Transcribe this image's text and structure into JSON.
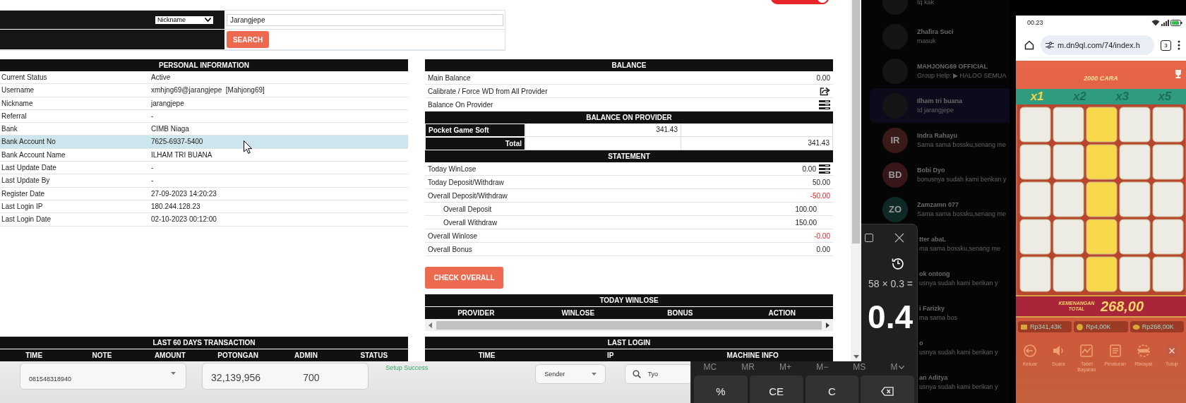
{
  "admin_window": {
    "toggle": {
      "on": true
    },
    "search": {
      "field_select": "Nickname",
      "value": "Jarangjepe",
      "button": "SEARCH"
    },
    "personal_information": {
      "title": "PERSONAL INFORMATION",
      "rows": [
        {
          "label": "Current Status",
          "value": "Active",
          "highlighted": false
        },
        {
          "label": "Username",
          "value": "xmhjng69@jarangjepe  [Mahjong69]",
          "highlighted": false
        },
        {
          "label": "Nickname",
          "value": "jarangjepe",
          "highlighted": false
        },
        {
          "label": "Referral",
          "value": "-",
          "highlighted": false
        },
        {
          "label": "Bank",
          "value": "CIMB Niaga",
          "highlighted": false
        },
        {
          "label": "Bank Account No",
          "value": "7625-6937-5400",
          "highlighted": true
        },
        {
          "label": "Bank Account Name",
          "value": "ILHAM TRI BUANA",
          "highlighted": false
        },
        {
          "label": "Last Update Date",
          "value": "-",
          "highlighted": false
        },
        {
          "label": "Last Update By",
          "value": "-",
          "highlighted": false
        },
        {
          "label": "Register Date",
          "value": "27-09-2023 14:20:23",
          "highlighted": false
        },
        {
          "label": "Last Login IP",
          "value": "180.244.128.23",
          "highlighted": false
        },
        {
          "label": "Last Login Date",
          "value": "02-10-2023 00:12:00",
          "highlighted": false
        }
      ]
    },
    "balance": {
      "title": "BALANCE",
      "rows": [
        {
          "label": "Main Balance",
          "value": "0.00",
          "kind": "value"
        },
        {
          "label": "Calibrate / Force WD from All Provider",
          "kind": "share"
        },
        {
          "label": "Balance On Provider",
          "kind": "list"
        }
      ]
    },
    "balance_on_provider": {
      "title": "BALANCE ON PROVIDER",
      "rows": [
        {
          "label": "Pocket Game Soft",
          "value": "341.43",
          "kind": "provider"
        },
        {
          "label": "Total",
          "value": "341.43",
          "kind": "total"
        }
      ]
    },
    "statement": {
      "title": "STATEMENT",
      "rows": [
        {
          "label": "Today WinLose",
          "value": "0.00",
          "kind": "list",
          "negative": false
        },
        {
          "label": "Today Deposit/Withdraw",
          "value": "50.00",
          "kind": "main",
          "negative": false
        },
        {
          "label": "Overall Deposit/Withdraw",
          "value": "-50.00",
          "kind": "main",
          "negative": true
        },
        {
          "label": "Overall Deposit",
          "value": "100.00",
          "kind": "sub",
          "negative": false
        },
        {
          "label": "Overall Withdraw",
          "value": "150.00",
          "kind": "sub",
          "negative": false
        },
        {
          "label": "Overall Winlose",
          "value": "-0.00",
          "kind": "main",
          "negative": true
        },
        {
          "label": "Overall Bonus",
          "value": "0.00",
          "kind": "main",
          "negative": false
        }
      ]
    },
    "check_button": "CHECK OVERALL",
    "today_winlose": {
      "title": "TODAY WINLOSE",
      "columns": [
        "PROVIDER",
        "WINLOSE",
        "BONUS",
        "ACTION"
      ]
    },
    "last_60_days_transaction": {
      "title": "LAST 60 DAYS TRANSACTION",
      "columns": [
        "TIME",
        "NOTE",
        "AMOUNT",
        "POTONGAN",
        "ADMIN",
        "STATUS"
      ]
    },
    "last_login": {
      "title": "LAST LOGIN",
      "columns": [
        "TIME",
        "IP",
        "MACHINE INFO"
      ]
    }
  },
  "background_app": {
    "phone_field": "081548318940",
    "amount": "32,139,956",
    "fee": "700",
    "status": "Setup Success",
    "sender_select": "Sender",
    "search_value": "Tyo"
  },
  "calculator": {
    "expression": "58 × 0.3 =",
    "display": "0.4",
    "memory": [
      {
        "label": "MC",
        "kind": "text"
      },
      {
        "label": "MR",
        "kind": "text"
      },
      {
        "label": "M+",
        "kind": "text"
      },
      {
        "label": "M−",
        "kind": "text"
      },
      {
        "label": "MS",
        "kind": "text"
      },
      {
        "label": "M",
        "kind": "dropdown"
      }
    ],
    "keys": [
      {
        "label": "%",
        "kind": "text"
      },
      {
        "label": "CE",
        "kind": "text"
      },
      {
        "label": "C",
        "kind": "text"
      },
      {
        "kind": "backspace"
      }
    ]
  },
  "chat_list": {
    "items": [
      {
        "message": "tq kak",
        "selected": false,
        "clipped": false
      },
      {
        "name": "Zhafira Suci",
        "message": "masuk",
        "selected": false,
        "clipped": false
      },
      {
        "name": "MAHJONG69 OFFICIAL",
        "message": "Group Help: ▶ HALOO SEMUA",
        "selected": false,
        "clipped": false
      },
      {
        "name": "Ilham tri buana",
        "message": "Id jarangjepe",
        "selected": true,
        "clipped": false
      },
      {
        "name": "Indra Rahayu",
        "message": "Sama sama bossku,senang me",
        "initials": "IR",
        "color": "#3a1a16",
        "selected": false,
        "clipped": false
      },
      {
        "name": "Bobi Dyo",
        "message": "bonusnya sudah kami berikan y",
        "initials": "BD",
        "color": "#361619",
        "selected": false,
        "clipped": false
      },
      {
        "name": "Zamzamn 077",
        "message": "Sama sama bossku,senang me",
        "initials": "ZO",
        "color": "#0f2a26",
        "selected": false,
        "clipped": false
      },
      {
        "name": "tter abaL",
        "message": "ma sama bossku,senang me",
        "selected": false,
        "clipped": true
      },
      {
        "name": "ok ontong",
        "message": "usnya sudah kami berikan y",
        "selected": false,
        "clipped": true
      },
      {
        "name": "i Farizky",
        "message": "ma sama bos",
        "selected": false,
        "clipped": true
      },
      {
        "name": "o",
        "message": "usnya sudah kami berikan y",
        "selected": false,
        "clipped": true
      },
      {
        "name": "an Aditya",
        "message": "usnya sudah kami berikan y",
        "selected": false,
        "clipped": true
      }
    ]
  },
  "phone": {
    "time": "00.23",
    "url": "m.dn9ql.com/74/index.h",
    "tab_count": "3",
    "game": {
      "ways": "2000 CARA",
      "multipliers": [
        {
          "label": "x1",
          "selected": true
        },
        {
          "label": "x2",
          "selected": false
        },
        {
          "label": "x3",
          "selected": false
        },
        {
          "label": "x5",
          "selected": false
        }
      ],
      "total_label": "KEMENANGAN TOTAL",
      "total": "268,00",
      "balances": [
        {
          "value": "Rp341,43K",
          "kind": "wallet"
        },
        {
          "value": "Rp4,00K",
          "kind": "bet"
        },
        {
          "value": "Rp268,00K",
          "kind": "win"
        }
      ],
      "buttons": [
        {
          "label": "Keluar",
          "kind": "exit"
        },
        {
          "label": "Suara",
          "kind": "sound"
        },
        {
          "label": "Tabel Bayaran",
          "kind": "paytable"
        },
        {
          "label": "Peraturan",
          "kind": "rules"
        },
        {
          "label": "Riwayat",
          "kind": "history"
        },
        {
          "label": "Tutup",
          "kind": "close"
        }
      ]
    }
  }
}
